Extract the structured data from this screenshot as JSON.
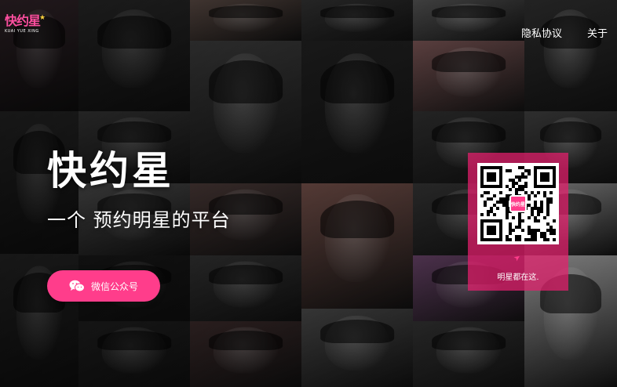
{
  "brand": {
    "logo_text": "快约星",
    "logo_sub": "KUAI YUE XING"
  },
  "nav": {
    "privacy": "隐私协议",
    "about": "关于"
  },
  "hero": {
    "title": "快约星",
    "subtitle": "一个 预约明星的平台"
  },
  "wechat_button": {
    "label": "微信公众号",
    "icon": "wechat-icon"
  },
  "qr": {
    "center_label": "快约星",
    "caption": "明星都在这."
  },
  "colors": {
    "accent": "#ff3d8b",
    "panel": "#e81e6e",
    "logo_star": "#ffd23f"
  }
}
